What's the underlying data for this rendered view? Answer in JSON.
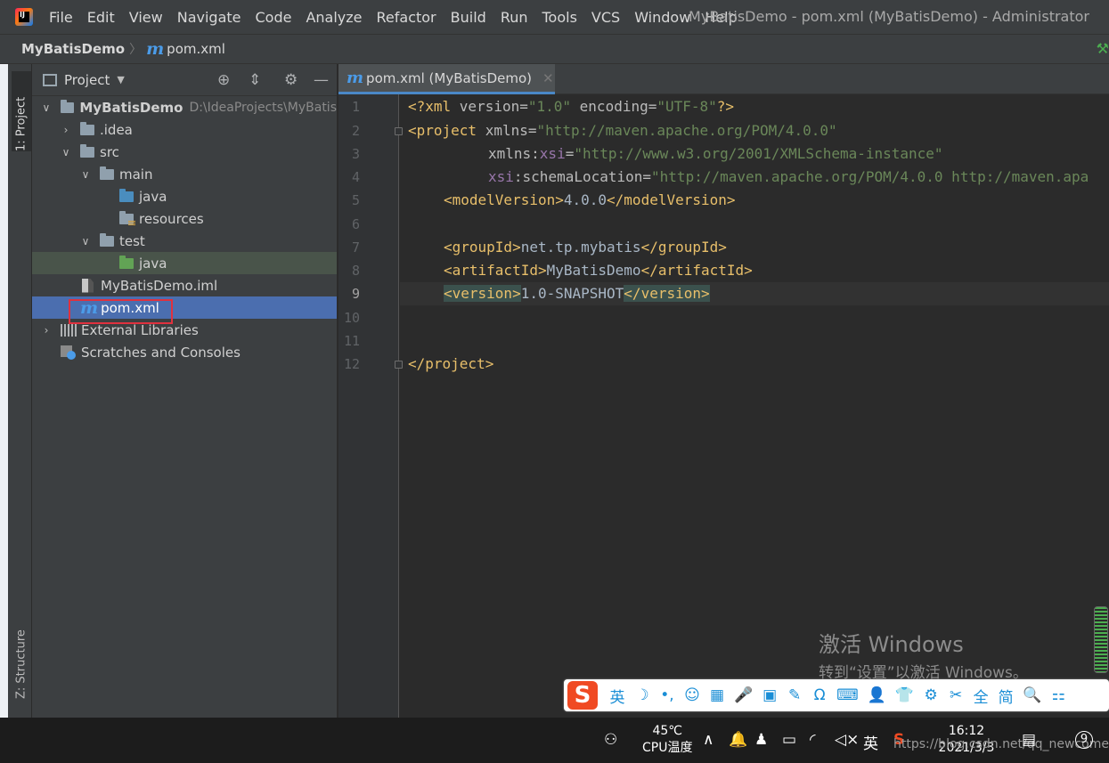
{
  "menubar": {
    "items": [
      "File",
      "Edit",
      "View",
      "Navigate",
      "Code",
      "Analyze",
      "Refactor",
      "Build",
      "Run",
      "Tools",
      "VCS",
      "Window",
      "Help"
    ],
    "window_title": "MyBatisDemo - pom.xml (MyBatisDemo) - Administrator"
  },
  "navbar": {
    "project": "MyBatisDemo",
    "file": "pom.xml"
  },
  "left_strip": {
    "project_tab": "1: Project",
    "structure_tab": "Z: Structure"
  },
  "project_panel": {
    "title": "Project",
    "tree": [
      {
        "label": "MyBatisDemo",
        "hint": "D:\\IdeaProjects\\MyBatis",
        "depth": 0,
        "arrow": "down",
        "icon": "module-folder-icon"
      },
      {
        "label": ".idea",
        "depth": 1,
        "arrow": "right",
        "icon": "folder-icon"
      },
      {
        "label": "src",
        "depth": 1,
        "arrow": "down",
        "icon": "folder-icon"
      },
      {
        "label": "main",
        "depth": 2,
        "arrow": "down",
        "icon": "folder-icon"
      },
      {
        "label": "java",
        "depth": 3,
        "arrow": "none",
        "icon": "source-folder-icon"
      },
      {
        "label": "resources",
        "depth": 3,
        "arrow": "none",
        "icon": "resources-folder-icon"
      },
      {
        "label": "test",
        "depth": 2,
        "arrow": "down",
        "icon": "folder-icon"
      },
      {
        "label": "java",
        "depth": 3,
        "arrow": "none",
        "icon": "test-folder-icon"
      },
      {
        "label": "MyBatisDemo.iml",
        "depth": 2,
        "arrow": "none",
        "icon": "iml-file-icon"
      },
      {
        "label": "pom.xml",
        "depth": 2,
        "arrow": "none",
        "icon": "maven-icon"
      },
      {
        "label": "External Libraries",
        "depth": 0,
        "arrow": "right",
        "icon": "library-icon"
      },
      {
        "label": "Scratches and Consoles",
        "depth": 0,
        "arrow": "none",
        "icon": "scratch-icon"
      }
    ]
  },
  "editor": {
    "tab_label": "pom.xml (MyBatisDemo)",
    "line_numbers": [
      "1",
      "2",
      "3",
      "4",
      "5",
      "6",
      "7",
      "8",
      "9",
      "10",
      "11",
      "12"
    ],
    "active_line": 9,
    "code": {
      "l1_decl_open": "<?xml ",
      "l1_version_attr": "version=",
      "l1_version_val": "\"1.0\"",
      "l1_encoding_attr": " encoding=",
      "l1_encoding_val": "\"UTF-8\"",
      "l1_decl_close": "?>",
      "l2_tag": "<project ",
      "l2_attr": "xmlns=",
      "l2_val": "\"http://maven.apache.org/POM/4.0.0\"",
      "l3_attr": "xmlns:",
      "l3_ns": "xsi",
      "l3_eq": "=",
      "l3_val": "\"http://www.w3.org/2001/XMLSchema-instance\"",
      "l4_ns": "xsi",
      "l4_attr": ":schemaLocation=",
      "l4_val": "\"http://maven.apache.org/POM/4.0.0 http://maven.apa",
      "l5_open": "<modelVersion>",
      "l5_text": "4.0.0",
      "l5_close": "</modelVersion>",
      "l7_open": "<groupId>",
      "l7_text": "net.tp.mybatis",
      "l7_close": "</groupId>",
      "l8_open": "<artifactId>",
      "l8_text": "MyBatisDemo",
      "l8_close": "</artifactId>",
      "l9_open": "<version>",
      "l9_text": "1.0-SNAPSHOT",
      "l9_close": "</version>",
      "l12_close": "</project>"
    }
  },
  "watermark": {
    "title": "激活 Windows",
    "subtitle": "转到“设置”以激活 Windows。"
  },
  "ime_bar": {
    "logo": "S",
    "items": [
      "英",
      "☽",
      "•,",
      "☺",
      "▦",
      "🎤",
      "▣",
      "✎",
      "Ω",
      "⌨",
      "👤",
      "👕",
      "⚙",
      "✂",
      "全",
      "简",
      "🔍",
      "⚏"
    ]
  },
  "taskbar": {
    "temperature": "45℃",
    "temp_label": "CPU温度",
    "language": "英",
    "time": "16:12",
    "date": "2021/3/3",
    "notification_count": "9",
    "source_watermark": "https://blog.csdn.net/qq_newcome"
  }
}
